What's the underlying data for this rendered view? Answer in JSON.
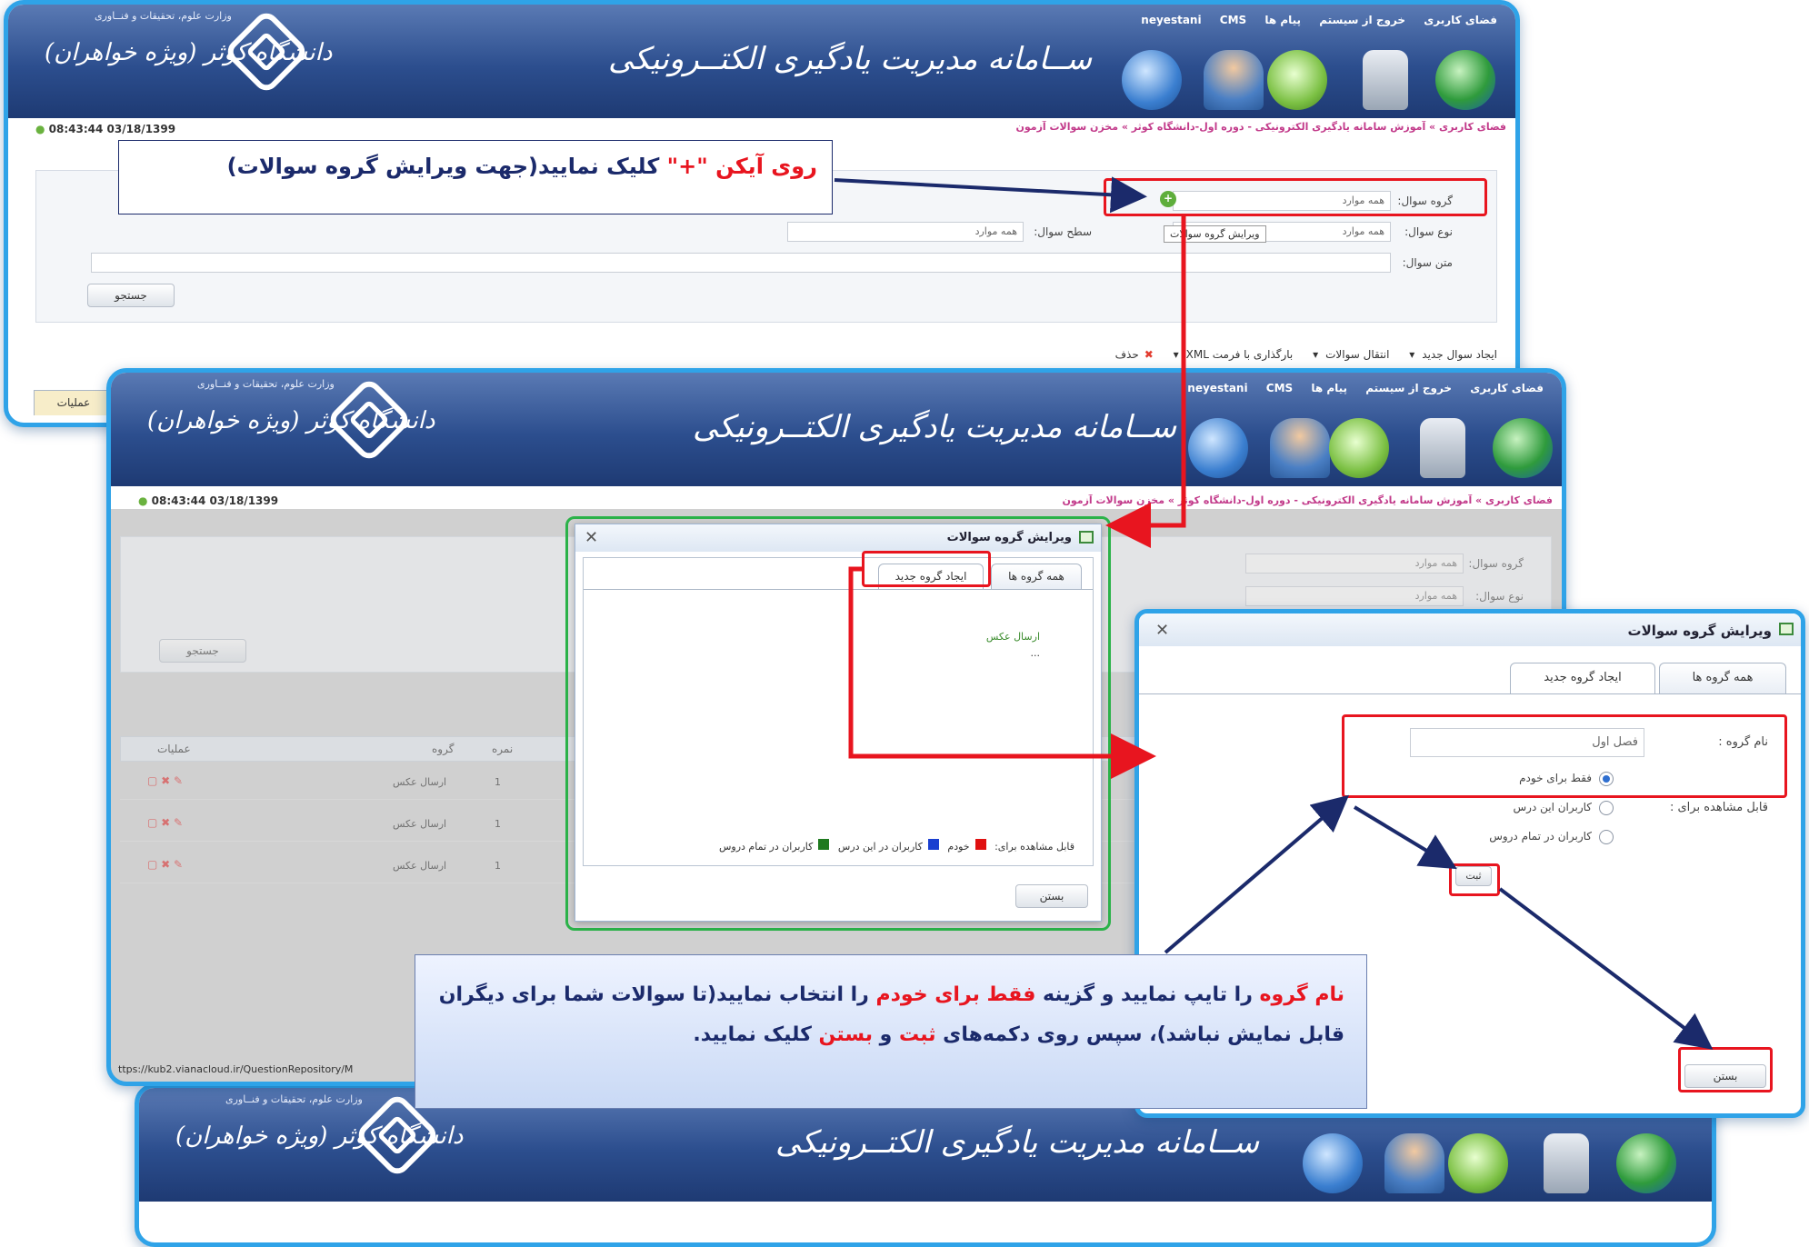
{
  "banner": {
    "ministry": "وزارت علوم، تحقیقات و فنــاوری",
    "university": "دانشگاه کوثر (ویژه خواهران)",
    "system_title": "ســامانه مدیریت یادگیری الکتــرونیکی",
    "links": {
      "user_space": "فضای کاربری",
      "logout": "خروج از سیستم",
      "messages": "پیام ها",
      "username": "neyestani",
      "cms": "CMS"
    }
  },
  "status": {
    "clock": "08:43:44 03/18/1399",
    "breadcrumb": "فضای کاربری » آموزش سامانه یادگیری الکترونیکی - دوره اول-دانشگاه کوثر » مخزن سوالات آزمون"
  },
  "search": {
    "group_label": "گروه سوال:",
    "group_value": "همه موارد",
    "type_label": "نوع سوال:",
    "type_value": "همه موارد",
    "level_label": "سطح سوال:",
    "level_value": "همه موارد",
    "text_label": "متن سوال:",
    "search_button": "جستجو",
    "tooltip": "ویرایش گروه سوالات"
  },
  "toolbar": {
    "new_question": "ایجاد سوال جدید",
    "move_questions": "انتقال سوالات",
    "upload_xml": "بارگذاری با فرمت XML",
    "delete": "حذف"
  },
  "table": {
    "headers": {
      "actions": "عملیات",
      "group": "گروه",
      "score": "نمره"
    },
    "rows": [
      {
        "group": "ارسال عکس",
        "score": "1"
      },
      {
        "group": "ارسال عکس",
        "score": "1"
      },
      {
        "group": "ارسال عکس",
        "score": "1"
      }
    ]
  },
  "dialog_groups": {
    "title": "ویرایش گروه سوالات",
    "tab_all": "همه گروه ها",
    "tab_new": "ایجاد گروه جدید",
    "tree_item": "ارسال عکس",
    "tree_more": "...",
    "legend_label": "قابل مشاهده برای:",
    "legend_self": "خودم",
    "legend_course": "کاربران در این درس",
    "legend_all": "کاربران در تمام دروس",
    "close_button": "بستن"
  },
  "dialog_new": {
    "title": "ویرایش گروه سوالات",
    "tab_all": "همه گروه ها",
    "tab_new": "ایجاد گروه جدید",
    "name_label": "نام گروه :",
    "name_value": "فصل اول",
    "visible_label": "قابل مشاهده برای :",
    "opt_self": "فقط برای خودم",
    "opt_course": "کاربران این درس",
    "opt_all": "کاربران در تمام دروس",
    "submit_button": "ثبت",
    "close_button": "بستن"
  },
  "annotations": {
    "note1_a": "روی آیکن ",
    "note1_b": "\"+\"",
    "note1_c": " کلیک نمایید(جهت ویرایش گروه سوالات)",
    "note2_p1": "نام گروه",
    "note2_p2": " را تایپ نمایید و گزینه ",
    "note2_p3": "فقط برای خودم",
    "note2_p4": " را انتخاب نمایید(تا سوالات شما برای دیگران قابل نمایش نباشد)، سپس روی دکمه‌های ",
    "note2_p5": "ثبت",
    "note2_p6": " و ",
    "note2_p7": "بستن",
    "note2_p8": " کلیک نمایید."
  },
  "url_fragment": "ttps://kub2.vianacloud.ir/QuestionRepository/M",
  "colors": {
    "accent_red": "#e8151f",
    "accent_green": "#2cb34a",
    "banner_blue": "#2c4e8e",
    "frame_blue": "#2fa3e8",
    "note_navy": "#1b2a6b"
  }
}
